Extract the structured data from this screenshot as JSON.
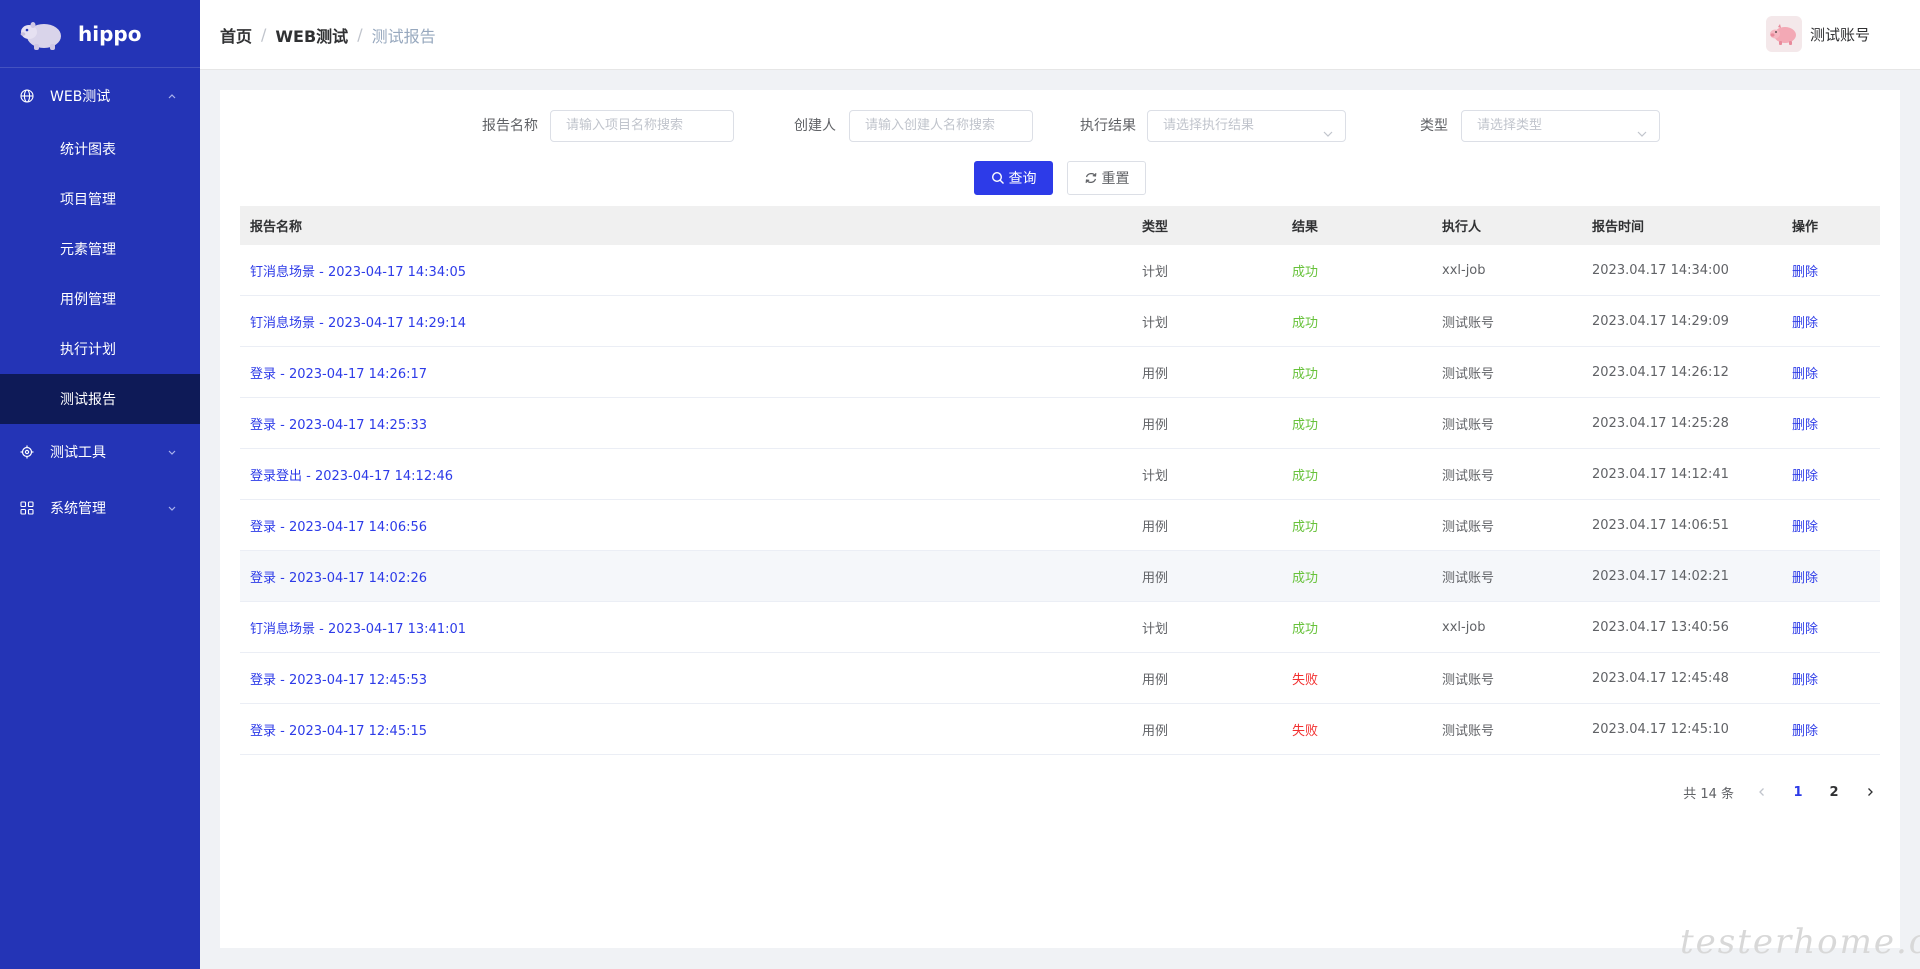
{
  "app": {
    "name": "hippo"
  },
  "sidebar": {
    "groups": [
      {
        "label": "WEB测试",
        "icon": "globe-icon",
        "expanded": true,
        "items": [
          {
            "label": "统计图表"
          },
          {
            "label": "项目管理"
          },
          {
            "label": "元素管理"
          },
          {
            "label": "用例管理"
          },
          {
            "label": "执行计划"
          },
          {
            "label": "测试报告",
            "active": true
          }
        ]
      },
      {
        "label": "测试工具",
        "icon": "gear-icon",
        "expanded": false
      },
      {
        "label": "系统管理",
        "icon": "grid-icon",
        "expanded": false
      }
    ]
  },
  "header": {
    "breadcrumb": [
      "首页",
      "WEB测试",
      "测试报告"
    ],
    "separator": "/",
    "user": {
      "name": "测试账号",
      "avatar_icon": "pig-avatar-icon"
    }
  },
  "filters": {
    "report_name": {
      "label": "报告名称",
      "placeholder": "请输入项目名称搜索"
    },
    "creator": {
      "label": "创建人",
      "placeholder": "请输入创建人名称搜索"
    },
    "result": {
      "label": "执行结果",
      "placeholder": "请选择执行结果"
    },
    "type": {
      "label": "类型",
      "placeholder": "请选择类型"
    },
    "search_label": "查询",
    "reset_label": "重置"
  },
  "table": {
    "columns": [
      "报告名称",
      "类型",
      "结果",
      "执行人",
      "报告时间",
      "操作"
    ],
    "rows": [
      {
        "name": "钉消息场景 - 2023-04-17 14:34:05",
        "type": "计划",
        "result": "成功",
        "status": "success",
        "executor": "xxl-job",
        "time": "2023.04.17 14:34:00",
        "action": "删除"
      },
      {
        "name": "钉消息场景 - 2023-04-17 14:29:14",
        "type": "计划",
        "result": "成功",
        "status": "success",
        "executor": "测试账号",
        "time": "2023.04.17 14:29:09",
        "action": "删除"
      },
      {
        "name": "登录 - 2023-04-17 14:26:17",
        "type": "用例",
        "result": "成功",
        "status": "success",
        "executor": "测试账号",
        "time": "2023.04.17 14:26:12",
        "action": "删除"
      },
      {
        "name": "登录 - 2023-04-17 14:25:33",
        "type": "用例",
        "result": "成功",
        "status": "success",
        "executor": "测试账号",
        "time": "2023.04.17 14:25:28",
        "action": "删除"
      },
      {
        "name": "登录登出 - 2023-04-17 14:12:46",
        "type": "计划",
        "result": "成功",
        "status": "success",
        "executor": "测试账号",
        "time": "2023.04.17 14:12:41",
        "action": "删除"
      },
      {
        "name": "登录 - 2023-04-17 14:06:56",
        "type": "用例",
        "result": "成功",
        "status": "success",
        "executor": "测试账号",
        "time": "2023.04.17 14:06:51",
        "action": "删除"
      },
      {
        "name": "登录 - 2023-04-17 14:02:26",
        "type": "用例",
        "result": "成功",
        "status": "success",
        "executor": "测试账号",
        "time": "2023.04.17 14:02:21",
        "action": "删除",
        "hovered": true
      },
      {
        "name": "钉消息场景 - 2023-04-17 13:41:01",
        "type": "计划",
        "result": "成功",
        "status": "success",
        "executor": "xxl-job",
        "time": "2023.04.17 13:40:56",
        "action": "删除"
      },
      {
        "name": "登录 - 2023-04-17 12:45:53",
        "type": "用例",
        "result": "失败",
        "status": "fail",
        "executor": "测试账号",
        "time": "2023.04.17 12:45:48",
        "action": "删除"
      },
      {
        "name": "登录 - 2023-04-17 12:45:15",
        "type": "用例",
        "result": "失败",
        "status": "fail",
        "executor": "测试账号",
        "time": "2023.04.17 12:45:10",
        "action": "删除"
      }
    ]
  },
  "pagination": {
    "total_text": "共 14 条",
    "pages": [
      "1",
      "2"
    ],
    "current": "1",
    "prev_icon": "chevron-left-icon",
    "next_icon": "chevron-right-icon"
  },
  "watermark": "testerhome.com",
  "colors": {
    "sidebar_bg": "#2434b6",
    "sidebar_active": "#0e1a57",
    "primary": "#2d3be8",
    "success": "#67c23a",
    "fail": "#f23030"
  }
}
